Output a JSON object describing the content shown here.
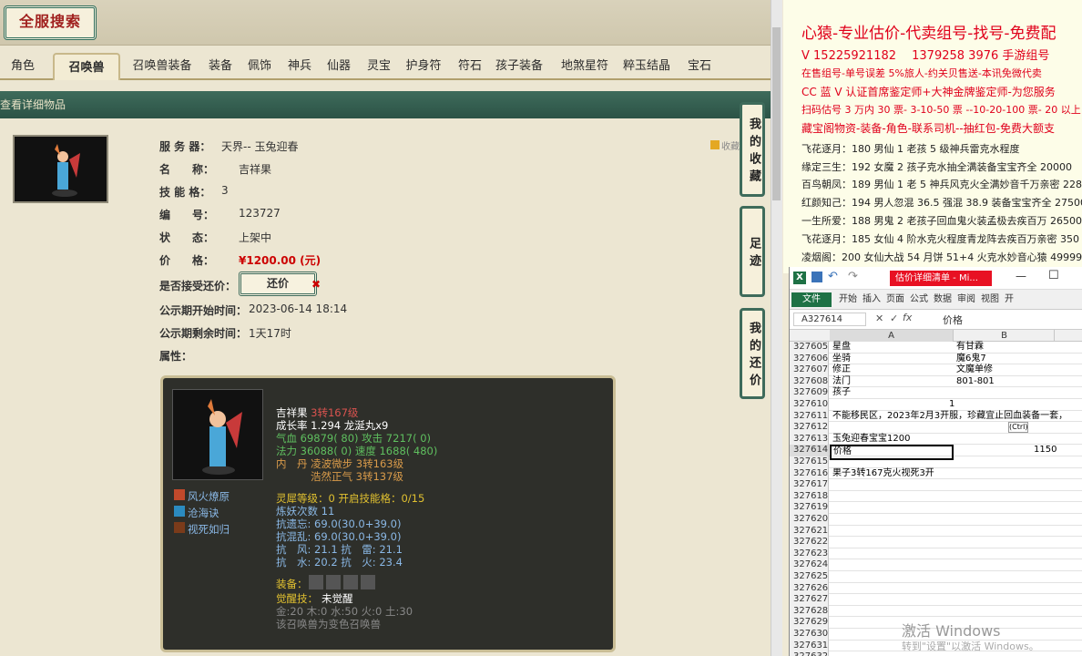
{
  "game": {
    "logo": "全服搜索",
    "tabs": [
      "角色",
      "召唤兽",
      "召唤兽装备",
      "装备",
      "佩饰",
      "神兵",
      "仙器",
      "灵宝",
      "护身符",
      "符石",
      "孩子装备",
      "地煞星符",
      "粹玉结晶",
      "宝石"
    ],
    "active_tab": "召唤兽",
    "section_title": "查看详细物品",
    "collect_label": "收藏",
    "fields": {
      "server_label": "服 务 器：",
      "server": "天界-- 玉兔迎春",
      "name_label": "名　　称：",
      "name": "吉祥果",
      "skills_label": "技 能 格：",
      "skills": "3",
      "id_label": "编　　号：",
      "id": "123727",
      "status_label": "状　　态：",
      "status": "上架中",
      "price_label": "价　　格：",
      "price": "¥1200.00 (元)",
      "counter_label": "是否接受还价：",
      "counter_btn": "还价",
      "pub_start_label": "公示期开始时间：",
      "pub_start": "2023-06-14 18:14",
      "pub_left_label": "公示期剩余时间：",
      "pub_left": "1天17时",
      "attr_label": "属性："
    },
    "detail": {
      "name": "吉祥果",
      "level": "3转167级",
      "growth": "成长率 1.294 龙涎丸x9",
      "hp_atk": "气血 69879( 80) 攻击 7217( 0)",
      "mp_spd": "法力 36088( 0) 速度 1688( 480)",
      "neidan1": "内　丹 凌波微步 3转163级",
      "neidan2": "浩然正气 3转137级",
      "skills": [
        "风火燎原",
        "沧海诀",
        "视死如归"
      ],
      "lingxi": "灵犀等级：0 开启技能格：0/15",
      "lianyao": "炼妖次数 11",
      "res1": "抗遗忘: 69.0(30.0+39.0)",
      "res2": "抗混乱: 69.0(30.0+39.0)",
      "res3": "抗　风: 21.1 抗　雷: 21.1",
      "res4": "抗　水: 20.2 抗　火: 23.4",
      "equip": "装备：",
      "awaken_label": "觉醒技：",
      "awaken": "未觉醒",
      "wuxing": "金:20 木:0 水:50 火:0 土:30",
      "bianse": "该召唤兽为变色召唤兽"
    },
    "side_buttons": [
      "我的收藏",
      "足迹",
      "我的还价"
    ]
  },
  "doc": {
    "lines": [
      "心猿-专业估价-代卖组号-找号-免费配",
      "V 15225921182　 1379258 3976 手游组号",
      "在售组号-单号误差 5%旅人-约关贝售送-本讯免微代卖",
      "CC 蓝 V 认证首席鉴定师+大神金牌鉴定师-为您服务",
      "扫码估号 3 万内 30 票- 3-10-50 票 --10-20-100 票- 20 以上 150",
      "藏宝阁物资-装备-角色-联系司机--抽红包-免费大额支",
      "飞花逐月：180 男仙 1 老孩 5 级神兵雷克水程度",
      "缘定三生：192 女魔 2 孩子克水抽全满装备宝宝齐全 20000",
      "百鸟朝凤：189 男仙 1 老 5 神兵风克火全满妙音千万亲密 228",
      "红颜知己：194 男人忽混 36.5 强混 38.9 装备宝宝齐全 27500",
      "一生所爱：188 男鬼 2 老孩子回血鬼火装孟极去疾百万 26500",
      "飞花逐月：185 女仙 4 阶水克火程度青龙阵去疾百万亲密 350",
      "凌烟阁：200 女仙大战 54 月饼 51+4 火克水妙音心猿 49999"
    ]
  },
  "excel": {
    "title": "估价详细清单 - Mi...",
    "ribbon": [
      "文件",
      "开始",
      "插入",
      "页面",
      "公式",
      "数据",
      "审阅",
      "视图",
      "开"
    ],
    "namebox": "A327614",
    "formula": "价格",
    "col_a": "A",
    "col_b": "B",
    "rows": [
      [
        "327605",
        "星盘",
        "有甘霖"
      ],
      [
        "327606",
        "坐骑",
        "魔6鬼7"
      ],
      [
        "327607",
        "修正",
        "文魔单修"
      ],
      [
        "327608",
        "法门",
        "801-801"
      ],
      [
        "327609",
        "孩子",
        ""
      ],
      [
        "327610",
        "1",
        ""
      ],
      [
        "327611",
        "不能移民区，2023年2月3开服，珍藏宜止回血装备一套，",
        ""
      ],
      [
        "327612",
        "",
        "(Ctrl)"
      ],
      [
        "327613",
        "玉兔迎春宝宝1200",
        ""
      ],
      [
        "327614",
        "价格",
        "1150"
      ],
      [
        "327615",
        "",
        ""
      ],
      [
        "327616",
        "果子3转167克火视死3开",
        ""
      ],
      [
        "327617",
        "",
        ""
      ],
      [
        "327618",
        "",
        ""
      ],
      [
        "327619",
        "",
        ""
      ],
      [
        "327620",
        "",
        ""
      ],
      [
        "327621",
        "",
        ""
      ],
      [
        "327622",
        "",
        ""
      ],
      [
        "327623",
        "",
        ""
      ],
      [
        "327624",
        "",
        ""
      ],
      [
        "327625",
        "",
        ""
      ],
      [
        "327626",
        "",
        ""
      ],
      [
        "327627",
        "",
        ""
      ],
      [
        "327628",
        "",
        ""
      ],
      [
        "327629",
        "",
        ""
      ],
      [
        "327630",
        "",
        ""
      ],
      [
        "327631",
        "",
        ""
      ],
      [
        "327632",
        "",
        ""
      ]
    ]
  },
  "watermark": {
    "line1": "激活 Windows",
    "line2": "转到\"设置\"以激活 Windows。"
  }
}
